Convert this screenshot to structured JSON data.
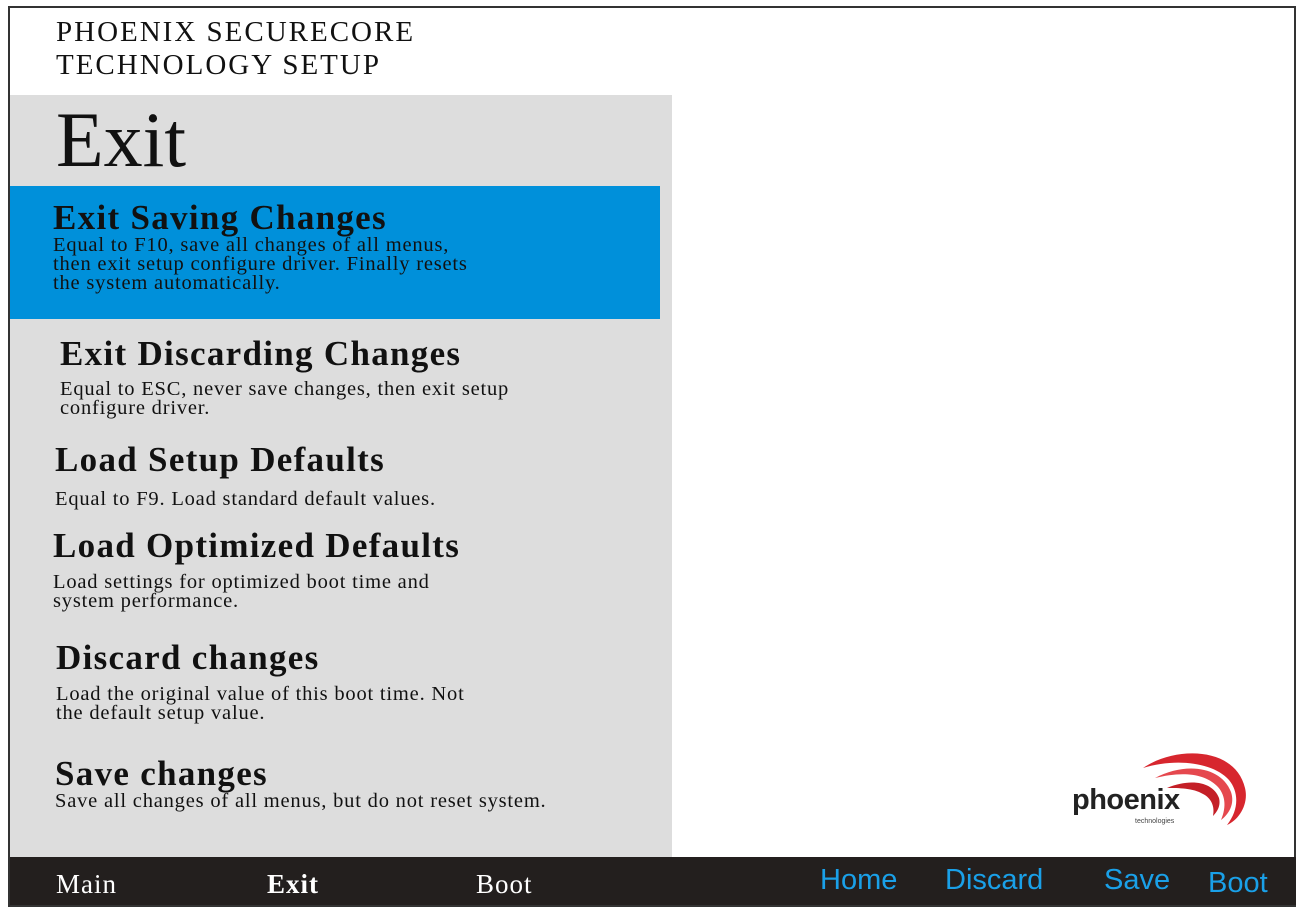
{
  "header": {
    "title_line1": "PHOENIX SECURECORE",
    "title_line2": "TECHNOLOGY SETUP"
  },
  "page": {
    "title": "Exit"
  },
  "menu": {
    "items": [
      {
        "label": "Exit Saving Changes",
        "description": "Equal to F10, save all changes of all menus,\nthen exit setup configure driver. Finally resets\nthe system automatically.",
        "selected": true
      },
      {
        "label": "Exit Discarding Changes",
        "description": "Equal to ESC, never save changes, then exit setup\nconfigure driver.",
        "selected": false
      },
      {
        "label": "Load Setup Defaults",
        "description": "Equal to F9. Load standard default values.",
        "selected": false
      },
      {
        "label": "Load Optimized Defaults",
        "description": "Load settings for optimized boot time and\nsystem performance.",
        "selected": false
      },
      {
        "label": "Discard changes",
        "description": "Load the original value of this boot time. Not\nthe default setup value.",
        "selected": false
      },
      {
        "label": "Save changes",
        "description": "Save all changes of all menus, but do not reset system.",
        "selected": false
      }
    ]
  },
  "logo": {
    "word": "phoenix",
    "sub": "technologies",
    "icon": "phoenix-swoosh-logo"
  },
  "bottom_nav": {
    "tabs": [
      {
        "label": "Main",
        "active": false
      },
      {
        "label": "Exit",
        "active": true
      },
      {
        "label": "Boot",
        "active": false
      }
    ],
    "keys": [
      {
        "label": "Home"
      },
      {
        "label": "Discard"
      },
      {
        "label": "Save"
      },
      {
        "label": "Boot"
      }
    ]
  },
  "colors": {
    "selection": "#0090da",
    "panel": "#dddddd",
    "bottom_bar": "#231f1e",
    "key_text": "#1aa0e8",
    "logo_red": "#d7262e"
  }
}
